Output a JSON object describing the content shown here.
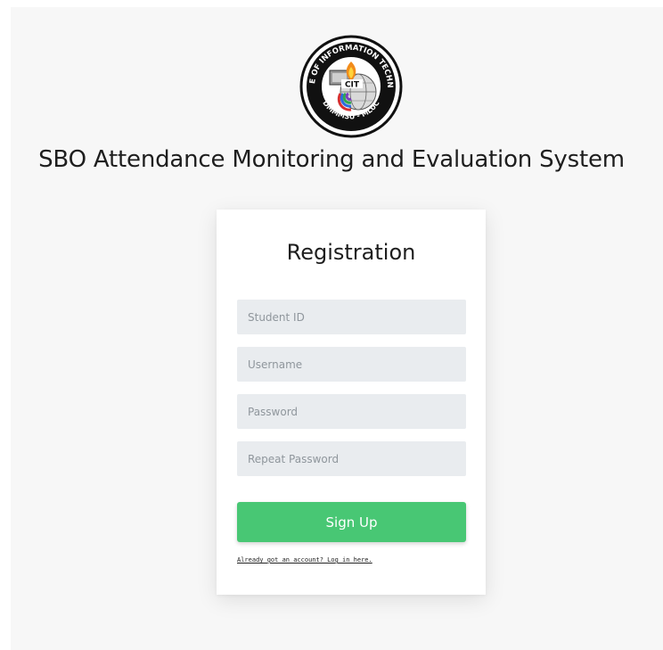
{
  "header": {
    "logo_ring_top": "COLLEGE OF INFORMATION TECHNOLOGY",
    "logo_ring_bottom": "DMMMSU - MLUC",
    "logo_center": "CIT",
    "title": "SBO Attendance Monitoring and Evaluation System"
  },
  "form": {
    "title": "Registration",
    "student_id": {
      "placeholder": "Student ID",
      "value": ""
    },
    "username": {
      "placeholder": "Username",
      "value": ""
    },
    "password": {
      "placeholder": "Password",
      "value": ""
    },
    "repeat_password": {
      "placeholder": "Repeat Password",
      "value": ""
    },
    "submit_label": "Sign Up",
    "login_link": "Already got an account? Log in here."
  },
  "colors": {
    "page_background": "#f7f7f7",
    "input_background": "#e9ecef",
    "button": "#48c774",
    "text": "#1e1e1e"
  }
}
